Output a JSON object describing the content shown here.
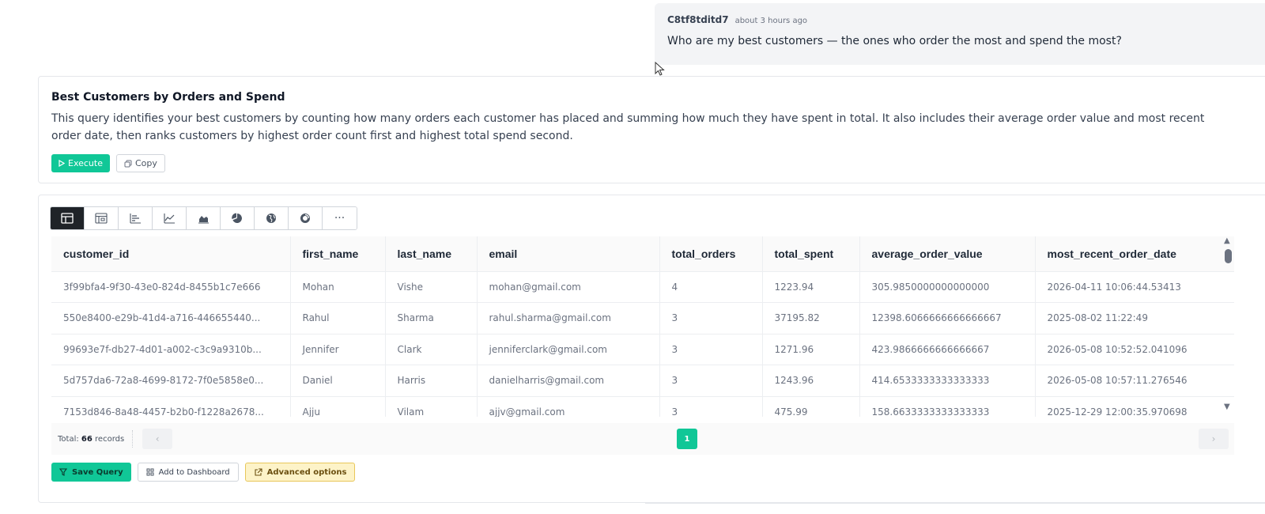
{
  "message": {
    "user": "C8tf8tditd7",
    "time": "about 3 hours ago",
    "text": "Who are my best customers — the ones who order the most and spend the most?"
  },
  "query": {
    "title": "Best Customers by Orders and Spend",
    "description": "This query identifies your best customers by counting how many orders each customer has placed and summing how much they have spent in total. It also includes their average order value and most recent order date, then ranks customers by highest order count first and highest total spend second.",
    "execute_label": "Execute",
    "copy_label": "Copy"
  },
  "toolbar": {
    "more_label": "···"
  },
  "table": {
    "columns": [
      "customer_id",
      "first_name",
      "last_name",
      "email",
      "total_orders",
      "total_spent",
      "average_order_value",
      "most_recent_order_date"
    ],
    "rows": [
      [
        "3f99bfa4-9f30-43e0-824d-8455b1c7e666",
        "Mohan",
        "Vishe",
        "mohan@gmail.com",
        "4",
        "1223.94",
        "305.9850000000000000",
        "2026-04-11 10:06:44.53413"
      ],
      [
        "550e8400-e29b-41d4-a716-446655440...",
        "Rahul",
        "Sharma",
        "rahul.sharma@gmail.com",
        "3",
        "37195.82",
        "12398.6066666666666667",
        "2025-08-02 11:22:49"
      ],
      [
        "99693e7f-db27-4d01-a002-c3c9a9310b...",
        "Jennifer",
        "Clark",
        "jenniferclark@gmail.com",
        "3",
        "1271.96",
        "423.9866666666666667",
        "2026-05-08 10:52:52.041096"
      ],
      [
        "5d757da6-72a8-4699-8172-7f0e5858e0...",
        "Daniel",
        "Harris",
        "danielharris@gmail.com",
        "3",
        "1243.96",
        "414.6533333333333333",
        "2026-05-08 10:57:11.276546"
      ],
      [
        "7153d846-8a48-4457-b2b0-f1228a2678...",
        "Ajju",
        "Vilam",
        "ajjv@gmail.com",
        "3",
        "475.99",
        "158.6633333333333333",
        "2025-12-29 12:00:35.970698"
      ]
    ]
  },
  "pagination": {
    "total_prefix": "Total:",
    "total_count": "66",
    "total_suffix": "records",
    "current_page": "1",
    "prev_label": "‹",
    "next_label": "›"
  },
  "actions": {
    "save_label": "Save Query",
    "dashboard_label": "Add to Dashboard",
    "advanced_label": "Advanced options"
  },
  "colors": {
    "accent": "#10c797",
    "toolbar_active": "#1f2328",
    "advanced_bg": "#fdf3c8"
  }
}
